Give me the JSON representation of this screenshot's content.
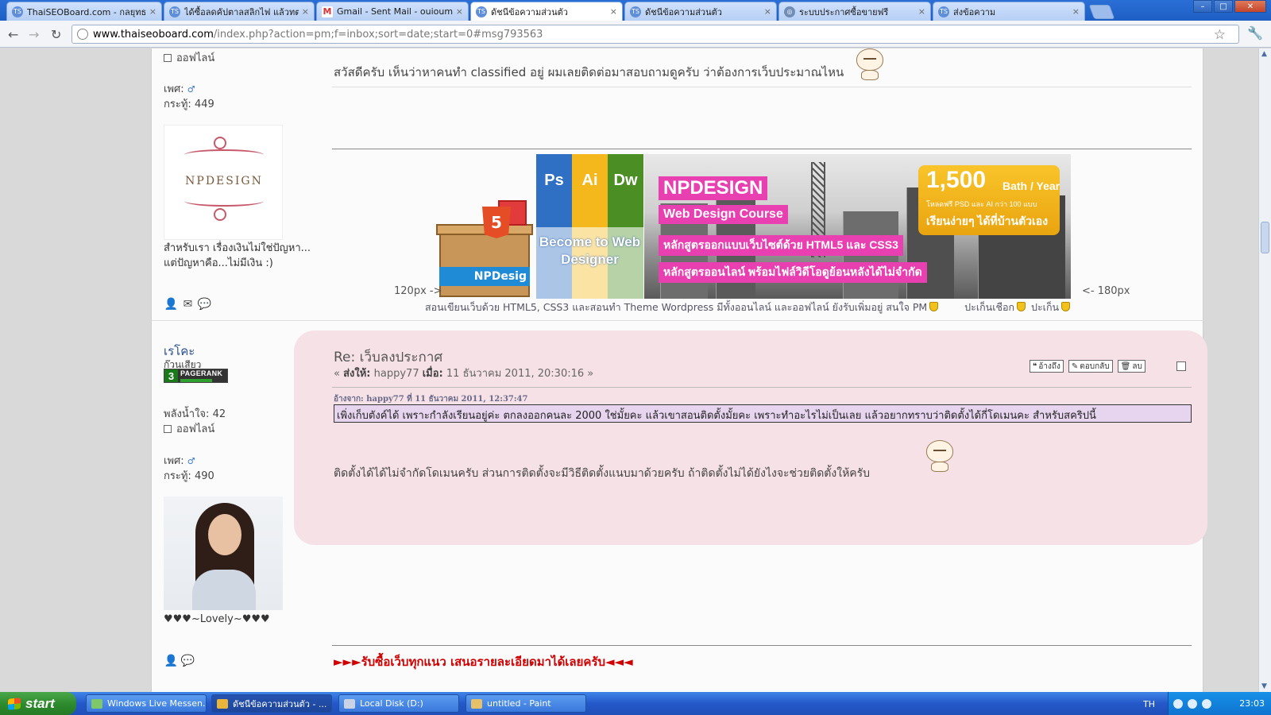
{
  "browser": {
    "tabs": [
      {
        "label": "ThaiSEOBoard.com - กลยุทธ S...",
        "icon": "seo-icon",
        "active": false
      },
      {
        "label": "ได้ซื้อลดคัปตาลสลิกไฟ แล้วทตลอ...",
        "icon": "seo-icon",
        "active": false
      },
      {
        "label": "Gmail - Sent Mail - ouioum11@...",
        "icon": "gmail-icon",
        "active": false
      },
      {
        "label": "ดัชนีข้อความส่วนตัว",
        "icon": "seo-icon",
        "active": true
      },
      {
        "label": "ดัชนีข้อความส่วนตัว",
        "icon": "seo-icon",
        "active": false
      },
      {
        "label": "ระบบประกาศซื้อขายฟรี",
        "icon": "globe-icon",
        "active": false
      },
      {
        "label": "ส่งข้อความ",
        "icon": "seo-icon",
        "active": false
      }
    ],
    "tab_close": "×",
    "url_host": "www.thaiseoboard.com",
    "url_path": "/index.php?action=pm;f=inbox;sort=date;start=0#msg793563",
    "nav": {
      "back": "←",
      "forward": "→",
      "reload": "↻",
      "star": "☆",
      "wrench": "🔧"
    },
    "window": {
      "minimize": "–",
      "maximize": "□",
      "close": "✕"
    }
  },
  "post1": {
    "status": "ออฟไลน์",
    "gender_label": "เพศ:",
    "gender_icon": "male-icon",
    "posts_label": "กระทู้:",
    "posts": "449",
    "avatar_text": "NPDESIGN",
    "signature": "สำหรับเรา เรื่องเงินไม่ใช่ปัญหา... แต่ปัญหาคือ...ไม่มีเงิน :)",
    "message": "สวัสดีครับ เห็นว่าหาคนทำ classified อยู่ ผมเลยติดต่อมาสอบถามดูครับ ว่าต้องการเว็บประมาณไหน",
    "banner": {
      "tools": [
        "Ps",
        "Ai",
        "Dw"
      ],
      "become": "Become to Web Designer",
      "pkg_label": "NPDesig",
      "brand": "NPDESIGN",
      "course": "Web Design Course",
      "line1": "หลักสูตรออกแบบเว็บไซต์ด้วย HTML5 และ CSS3",
      "line2": "หลักสูตรออนไลน์ พร้อมไฟล์วิดีโอดูย้อนหลังได้ไม่จำกัด",
      "price": "1,500",
      "price_unit": "Bath / Year",
      "price_sub": "โหลดฟรี PSD และ AI กว่า 100 แบบ",
      "price_learn": "เรียนง่ายๆ ได้ที่บ้านตัวเอง",
      "left_size": "120px ->",
      "right_size": "<- 180px"
    },
    "sig_line": "สอนเขียนเว็บด้วย HTML5, CSS3 และสอนทำ Theme Wordpress มีทั้งออนไลน์ และออฟไลน์ ยังรับเพิ่มอยู่ สนใจ PM",
    "sig_extra1": "ปะเก็นเชือก",
    "sig_extra2": "ปะเก็น"
  },
  "post2": {
    "author": "เรโคะ",
    "rank_title": "ก๊วนเสียว",
    "pagerank": "3",
    "pagerank_label": "PAGERANK",
    "karma_label": "พลังน้ำใจ:",
    "karma": "42",
    "status": "ออฟไลน์",
    "gender_label": "เพศ:",
    "posts_label": "กระทู้:",
    "posts": "490",
    "title": "Re: เว็บลงประกาศ",
    "meta_to_label": "ส่งให้:",
    "meta_to": "happy77",
    "meta_when_label": "เมื่อ:",
    "meta_when": "11 ธันวาคม 2011, 20:30:16",
    "quote_header": "อ้างจาก: happy77 ที่ 11 ธันวาคม 2011, 12:37:47",
    "quote": "เพิ่งเก็บตังค์ได้ เพราะกำลังเรียนอยู่ค่ะ ตกลงออกคนละ 2000 ใช่มั้ยคะ แล้วเขาสอนติดตั้งมั้ยคะ เพราะทำอะไรไม่เป็นเลย แล้วอยากทราบว่าติดตั้งได้กี่โดเมนคะ สำหรับสคริปนี้",
    "reply": "ติดตั้งได้ได้ไม่จำกัดโดเมนครับ ส่วนการติดตั้งจะมีวิธีติดตั้งแนบมาด้วยครับ ถ้าติดตั้งไม่ได้ยังไงจะช่วยติดตั้งให้ครับ",
    "actions": [
      "อ้างถึง",
      "ตอบกลับ",
      "ลบ"
    ],
    "signature": "♥♥♥~Lovely~♥♥♥",
    "promo": "►►►รับซื้อเว็บทุกแนว เสนอรายละเอียดมาได้เลยครับ◄◄◄"
  },
  "taskbar": {
    "start": "start",
    "items": [
      {
        "label": "Windows Live Messen...",
        "icon_color": "#7ec86a",
        "active": false
      },
      {
        "label": "ดัชนีข้อความส่วนตัว - ...",
        "icon_color": "#e9b43a",
        "active": true
      },
      {
        "label": "Local Disk (D:)",
        "icon_color": "#c9d3e3",
        "active": false
      },
      {
        "label": "untitled - Paint",
        "icon_color": "#e6c16a",
        "active": false
      }
    ],
    "lang": "TH",
    "clock": "23:03"
  },
  "colors": {
    "accent": "#2a6fd6",
    "highlight": "#f5e1e6",
    "quote_bg": "#e7d5ef",
    "promo": "#d10000",
    "pink": "#e83fb1"
  }
}
